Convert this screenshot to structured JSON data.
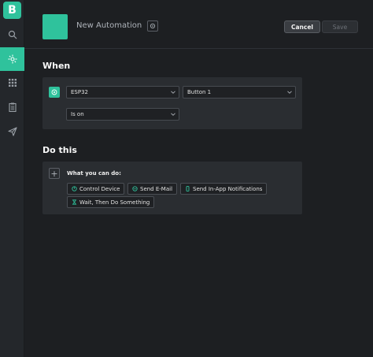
{
  "app": {
    "logo_letter": "B"
  },
  "sidebar": {
    "items": [
      {
        "icon": "search-icon"
      },
      {
        "icon": "automation-icon",
        "active": true
      },
      {
        "icon": "grid-icon"
      },
      {
        "icon": "clipboard-icon"
      },
      {
        "icon": "send-icon"
      }
    ]
  },
  "header": {
    "title": "New Automation",
    "cancel_label": "Cancel",
    "save_label": "Save"
  },
  "when": {
    "title": "When",
    "device": "ESP32",
    "datastream": "Button 1",
    "condition": "Is on"
  },
  "do_this": {
    "title": "Do this",
    "prompt": "What you can do:",
    "actions": [
      {
        "label": "Control Device",
        "icon": "power-icon"
      },
      {
        "label": "Send E-Mail",
        "icon": "email-icon"
      },
      {
        "label": "Send In-App Notifications",
        "icon": "phone-icon"
      },
      {
        "label": "Wait, Then Do Something",
        "icon": "hourglass-icon"
      }
    ]
  },
  "colors": {
    "accent": "#2fc29c",
    "background": "#1d1f22",
    "panel": "#2a2d31"
  }
}
